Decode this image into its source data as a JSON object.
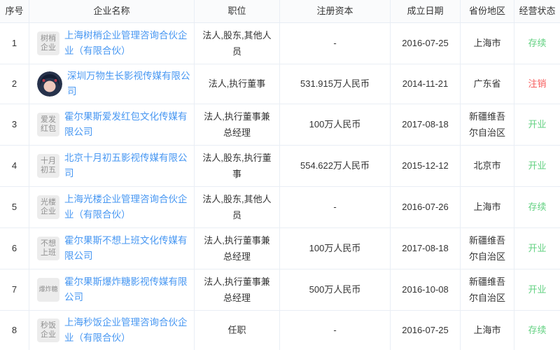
{
  "table": {
    "columns": [
      {
        "label": "序号"
      },
      {
        "label": "企业名称"
      },
      {
        "label": "职位"
      },
      {
        "label": "注册资本"
      },
      {
        "label": "成立日期"
      },
      {
        "label": "省份地区"
      },
      {
        "label": "经营状态"
      }
    ],
    "rows": [
      {
        "index": "1",
        "logo_type": "text",
        "logo_lines": [
          "树梢",
          "企业"
        ],
        "name": "上海树梢企业管理咨询合伙企业（有限合伙）",
        "position": "法人,股东,其他人员",
        "capital": "-",
        "date": "2016-07-25",
        "region": "上海市",
        "status": "存续",
        "status_color": "green"
      },
      {
        "index": "2",
        "logo_type": "image",
        "logo_lines": [],
        "name": "深圳万物生长影视传媒有限公司",
        "position": "法人,执行董事",
        "capital": "531.915万人民币",
        "date": "2014-11-21",
        "region": "广东省",
        "status": "注销",
        "status_color": "red"
      },
      {
        "index": "3",
        "logo_type": "text",
        "logo_lines": [
          "爱发",
          "红包"
        ],
        "name": "霍尔果斯爱发红包文化传媒有限公司",
        "position": "法人,执行董事兼总经理",
        "capital": "100万人民币",
        "date": "2017-08-18",
        "region": "新疆维吾尔自治区",
        "status": "开业",
        "status_color": "green"
      },
      {
        "index": "4",
        "logo_type": "text",
        "logo_lines": [
          "十月",
          "初五"
        ],
        "name": "北京十月初五影视传媒有限公司",
        "position": "法人,股东,执行董事",
        "capital": "554.622万人民币",
        "date": "2015-12-12",
        "region": "北京市",
        "status": "开业",
        "status_color": "green"
      },
      {
        "index": "5",
        "logo_type": "text",
        "logo_lines": [
          "光楼",
          "企业"
        ],
        "name": "上海光楼企业管理咨询合伙企业（有限合伙）",
        "position": "法人,股东,其他人员",
        "capital": "-",
        "date": "2016-07-26",
        "region": "上海市",
        "status": "存续",
        "status_color": "green"
      },
      {
        "index": "6",
        "logo_type": "text",
        "logo_lines": [
          "不想",
          "上班"
        ],
        "name": "霍尔果斯不想上班文化传媒有限公司",
        "position": "法人,执行董事兼总经理",
        "capital": "100万人民币",
        "date": "2017-08-18",
        "region": "新疆维吾尔自治区",
        "status": "开业",
        "status_color": "green"
      },
      {
        "index": "7",
        "logo_type": "text",
        "logo_lines": [
          "爆炸糖"
        ],
        "name": "霍尔果斯爆炸糖影视传媒有限公司",
        "position": "法人,执行董事兼总经理",
        "capital": "500万人民币",
        "date": "2016-10-08",
        "region": "新疆维吾尔自治区",
        "status": "开业",
        "status_color": "green"
      },
      {
        "index": "8",
        "logo_type": "text",
        "logo_lines": [
          "秒饭",
          "企业"
        ],
        "name": "上海秒饭企业管理咨询合伙企业（有限合伙）",
        "position": "任职",
        "capital": "-",
        "date": "2016-07-25",
        "region": "上海市",
        "status": "存续",
        "status_color": "green"
      }
    ],
    "colors": {
      "link": "#4797f2",
      "status_green": "#62d181",
      "status_red": "#f75b5b",
      "border": "#e9eef5",
      "logo_bg": "#ececec",
      "logo_text": "#909090"
    }
  }
}
